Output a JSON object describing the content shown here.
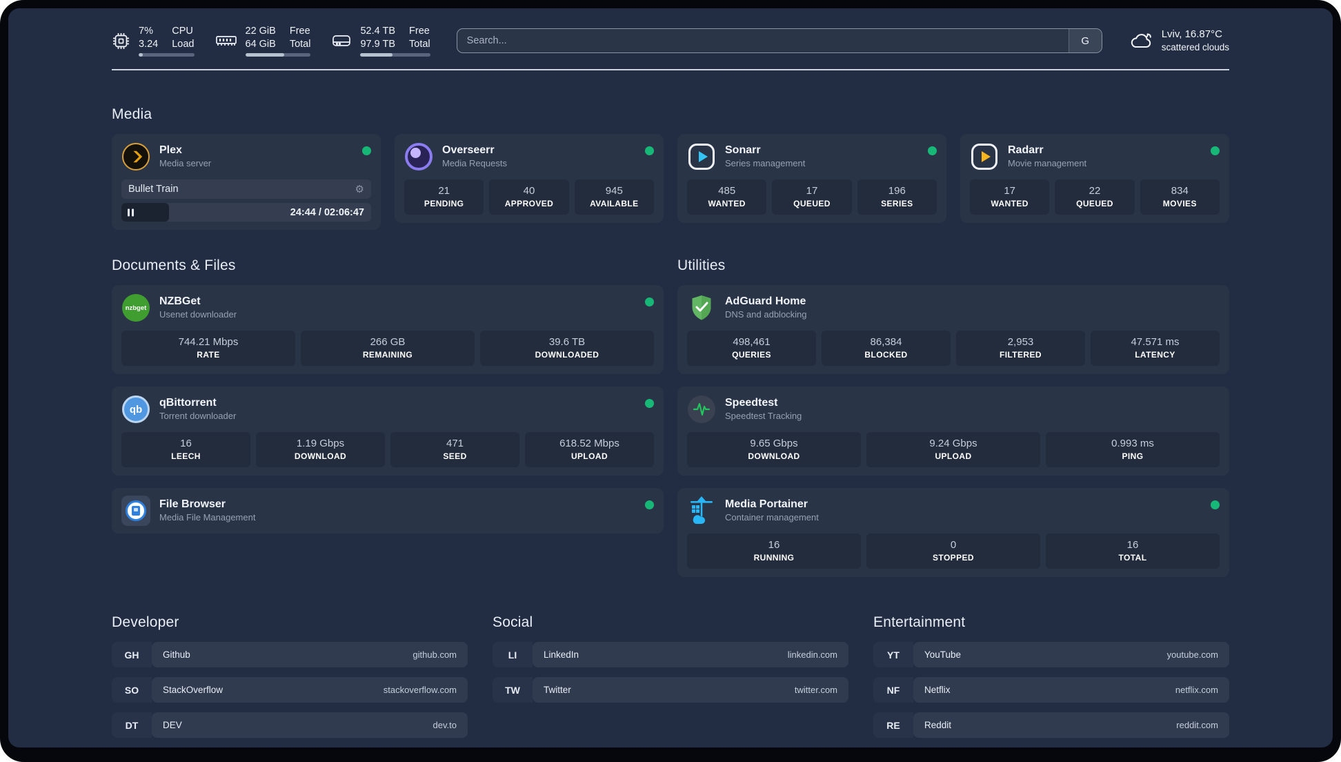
{
  "system": {
    "cpu": {
      "values": [
        "7%",
        "3.24"
      ],
      "labels": [
        "CPU",
        "Load"
      ],
      "progress": 7
    },
    "ram": {
      "values": [
        "22 GiB",
        "64 GiB"
      ],
      "labels": [
        "Free",
        "Total"
      ],
      "progress": 60
    },
    "disk": {
      "values": [
        "52.4 TB",
        "97.9 TB"
      ],
      "labels": [
        "Free",
        "Total"
      ],
      "progress": 46
    }
  },
  "search": {
    "placeholder": "Search...",
    "button_label": "G"
  },
  "weather": {
    "location": "Lviv, 16.87°C",
    "condition": "scattered clouds"
  },
  "sections": {
    "media": "Media",
    "documents": "Documents & Files",
    "utilities": "Utilities",
    "developer": "Developer",
    "social": "Social",
    "entertainment": "Entertainment"
  },
  "apps": {
    "plex": {
      "name": "Plex",
      "subtitle": "Media server",
      "player": {
        "title": "Bullet Train",
        "time": "24:44 / 02:06:47",
        "progress": 19
      }
    },
    "overseerr": {
      "name": "Overseerr",
      "subtitle": "Media Requests",
      "stats": [
        {
          "value": "21",
          "label": "PENDING"
        },
        {
          "value": "40",
          "label": "APPROVED"
        },
        {
          "value": "945",
          "label": "AVAILABLE"
        }
      ]
    },
    "sonarr": {
      "name": "Sonarr",
      "subtitle": "Series management",
      "stats": [
        {
          "value": "485",
          "label": "WANTED"
        },
        {
          "value": "17",
          "label": "QUEUED"
        },
        {
          "value": "196",
          "label": "SERIES"
        }
      ]
    },
    "radarr": {
      "name": "Radarr",
      "subtitle": "Movie management",
      "stats": [
        {
          "value": "17",
          "label": "WANTED"
        },
        {
          "value": "22",
          "label": "QUEUED"
        },
        {
          "value": "834",
          "label": "MOVIES"
        }
      ]
    },
    "nzbget": {
      "name": "NZBGet",
      "subtitle": "Usenet downloader",
      "icon_label": "nzbget",
      "stats": [
        {
          "value": "744.21 Mbps",
          "label": "RATE"
        },
        {
          "value": "266 GB",
          "label": "REMAINING"
        },
        {
          "value": "39.6 TB",
          "label": "DOWNLOADED"
        }
      ]
    },
    "qbittorrent": {
      "name": "qBittorrent",
      "subtitle": "Torrent downloader",
      "icon_label": "qb",
      "stats": [
        {
          "value": "16",
          "label": "LEECH"
        },
        {
          "value": "1.19 Gbps",
          "label": "DOWNLOAD"
        },
        {
          "value": "471",
          "label": "SEED"
        },
        {
          "value": "618.52 Mbps",
          "label": "UPLOAD"
        }
      ]
    },
    "filebrowser": {
      "name": "File Browser",
      "subtitle": "Media File Management"
    },
    "adguard": {
      "name": "AdGuard Home",
      "subtitle": "DNS and adblocking",
      "stats": [
        {
          "value": "498,461",
          "label": "QUERIES"
        },
        {
          "value": "86,384",
          "label": "BLOCKED"
        },
        {
          "value": "2,953",
          "label": "FILTERED"
        },
        {
          "value": "47.571 ms",
          "label": "LATENCY"
        }
      ]
    },
    "speedtest": {
      "name": "Speedtest",
      "subtitle": "Speedtest Tracking",
      "stats": [
        {
          "value": "9.65 Gbps",
          "label": "DOWNLOAD"
        },
        {
          "value": "9.24 Gbps",
          "label": "UPLOAD"
        },
        {
          "value": "0.993 ms",
          "label": "PING"
        }
      ]
    },
    "portainer": {
      "name": "Media Portainer",
      "subtitle": "Container management",
      "stats": [
        {
          "value": "16",
          "label": "RUNNING"
        },
        {
          "value": "0",
          "label": "STOPPED"
        },
        {
          "value": "16",
          "label": "TOTAL"
        }
      ]
    }
  },
  "bookmarks": {
    "developer": [
      {
        "abbr": "GH",
        "name": "Github",
        "url": "github.com"
      },
      {
        "abbr": "SO",
        "name": "StackOverflow",
        "url": "stackoverflow.com"
      },
      {
        "abbr": "DT",
        "name": "DEV",
        "url": "dev.to"
      }
    ],
    "social": [
      {
        "abbr": "LI",
        "name": "LinkedIn",
        "url": "linkedin.com"
      },
      {
        "abbr": "TW",
        "name": "Twitter",
        "url": "twitter.com"
      }
    ],
    "entertainment": [
      {
        "abbr": "YT",
        "name": "YouTube",
        "url": "youtube.com"
      },
      {
        "abbr": "NF",
        "name": "Netflix",
        "url": "netflix.com"
      },
      {
        "abbr": "RE",
        "name": "Reddit",
        "url": "reddit.com"
      }
    ]
  },
  "colors": {
    "status_online": "#17b877",
    "panel_bg": "#222c42",
    "card_bg": "#2a3447",
    "accent_plex": "#daa03a",
    "accent_sonarr": "#35c5f4",
    "accent_radarr": "#f6b41f",
    "accent_overseerr": "#8b7cf0",
    "accent_adguard": "#63b663",
    "accent_portainer": "#29b6f6"
  }
}
